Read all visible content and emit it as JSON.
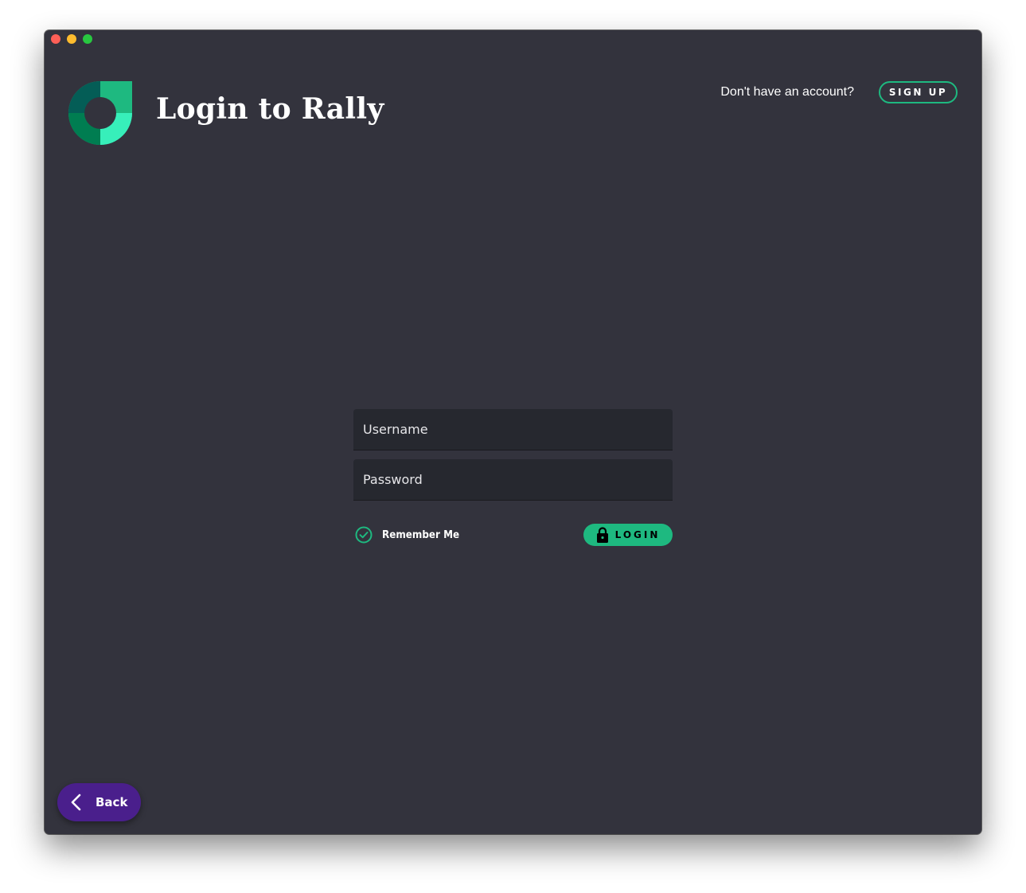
{
  "header": {
    "title": "Login to Rally",
    "account_prompt": "Don't have an account?",
    "signup_label": "SIGN UP"
  },
  "form": {
    "username_placeholder": "Username",
    "password_placeholder": "Password",
    "remember_label": "Remember Me",
    "remember_checked": true,
    "login_label": "LOGIN"
  },
  "footer": {
    "back_label": "Back"
  },
  "icons": {
    "logo": "rally-logo-icon",
    "check": "check-circle-icon",
    "lock": "lock-icon",
    "back": "chevron-left-icon"
  },
  "colors": {
    "background": "#33333d",
    "accent": "#1eb980",
    "back_button": "#4a1f8c",
    "field": "#26282f"
  }
}
